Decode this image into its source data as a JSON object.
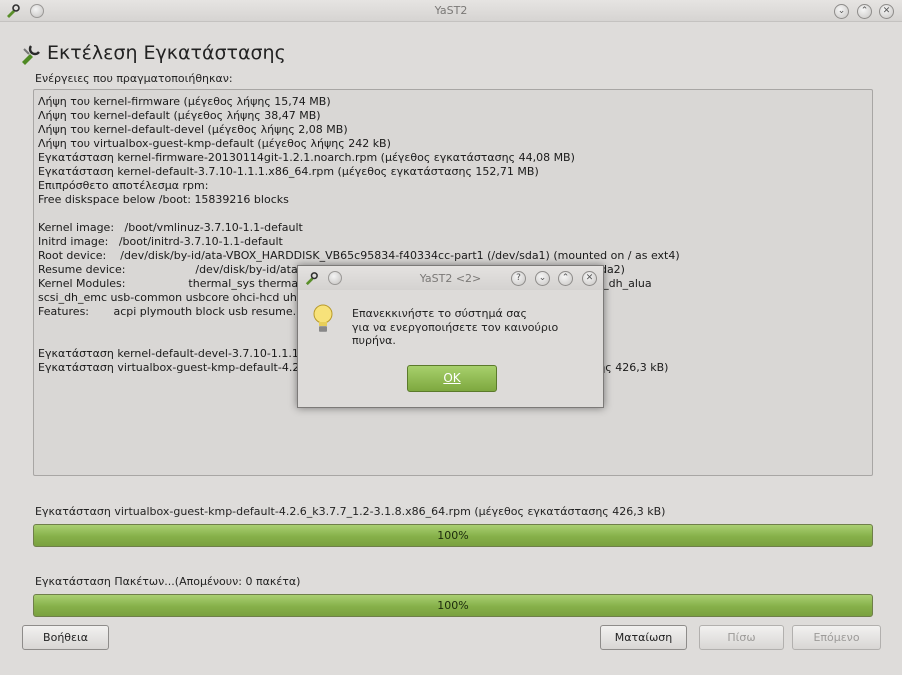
{
  "window": {
    "title": "YaST2"
  },
  "page": {
    "title": "Εκτέλεση Εγκατάστασης",
    "log_label": "Ενέργειες που πραγματοποιήθηκαν:"
  },
  "log_lines": [
    "Λήψη του kernel-firmware (μέγεθος λήψης 15,74 MB)",
    "Λήψη του kernel-default (μέγεθος λήψης 38,47 MB)",
    "Λήψη του kernel-default-devel (μέγεθος λήψης 2,08 MB)",
    "Λήψη του virtualbox-guest-kmp-default (μέγεθος λήψης 242 kB)",
    "Εγκατάσταση kernel-firmware-20130114git-1.2.1.noarch.rpm (μέγεθος εγκατάστασης 44,08 MB)",
    "Εγκατάσταση kernel-default-3.7.10-1.1.1.x86_64.rpm (μέγεθος εγκατάστασης 152,71 MB)",
    "Επιπρόσθετο αποτέλεσμα rpm:",
    "Free diskspace below /boot: 15839216 blocks",
    "",
    "Kernel image:   /boot/vmlinuz-3.7.10-1.1-default",
    "Initrd image:   /boot/initrd-3.7.10-1.1-default",
    "Root device:    /dev/disk/by-id/ata-VBOX_HARDDISK_VB65c95834-f40334cc-part1 (/dev/sda1) (mounted on / as ext4)",
    "Resume device:                    /dev/disk/by-id/ata-VBOX_HARDDISK_VB65c95834-f40334cc-part2 (/dev/sda2)",
    "Kernel Modules:                  thermal_sys thermal processor fan scsi_dh scsi_dh_hp_sw scsi_dh_rdac scsi_dh_alua",
    "scsi_dh_emc usb-common usbcore ohci-hcd uhci-hcd ehci-hcd xhci-hcd hid usbhid hid-generic",
    "Features:       acpi plymouth block usb resume.userspace resume.kernel",
    "",
    "",
    "Εγκατάσταση kernel-default-devel-3.7.10-1.1.1.x86_64.rpm (μέγεθος εγκατάστασης 8,39 MB)",
    "Εγκατάσταση virtualbox-guest-kmp-default-4.2.6_k3.7.7_1.2-3.1.8.x86_64.rpm (μέγεθος εγκατάστασης 426,3 kB)"
  ],
  "progress1": {
    "label": "Εγκατάσταση virtualbox-guest-kmp-default-4.2.6_k3.7.7_1.2-3.1.8.x86_64.rpm (μέγεθος εγκατάστασης 426,3 kB)",
    "value": 100,
    "text": "100%"
  },
  "progress2": {
    "label": "Εγκατάσταση Πακέτων...(Απομένουν: 0 πακέτα)",
    "value": 100,
    "text": "100%"
  },
  "buttons": {
    "help": "Βοήθεια",
    "abort": "Ματαίωση",
    "back": "Πίσω",
    "next": "Επόμενο"
  },
  "dialog": {
    "title": "YaST2 <2>",
    "message_line1": "Επανεκκινήστε το σύστημά σας",
    "message_line2": "για να ενεργοποιήσετε τον καινούριο πυρήνα.",
    "ok": "OK"
  },
  "colors": {
    "progress_green": "#86b049",
    "ok_green": "#8fbb52",
    "window_bg": "#dedcda"
  }
}
